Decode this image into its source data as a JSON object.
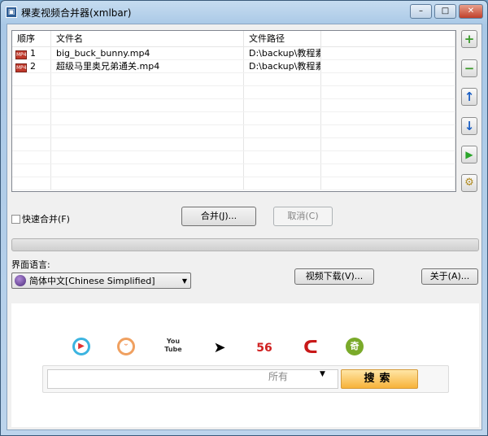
{
  "window": {
    "title": "稞麦视频合并器(xmlbar)",
    "minimize": "–",
    "maximize": "□",
    "close": "✕"
  },
  "table": {
    "headers": [
      "顺序",
      "文件名",
      "文件路径",
      ""
    ],
    "rows": [
      {
        "order": "1",
        "name": "big_buck_bunny.mp4",
        "path": "D:\\backup\\教程素材"
      },
      {
        "order": "2",
        "name": "超级马里奥兄弟通关.mp4",
        "path": "D:\\backup\\教程素材"
      }
    ],
    "file_icon": "MP4"
  },
  "side_buttons": {
    "add": "+",
    "remove": "−",
    "up": "↑",
    "down": "↓",
    "play": "▶",
    "settings": "⚙"
  },
  "fast_merge_label": "快速合并(F)",
  "merge_button": "合并(J)...",
  "cancel_button": "取消(C)",
  "progress": 0,
  "language_label": "界面语言:",
  "language_value": "简体中文[Chinese Simplified]",
  "video_download_button": "视频下载(V)...",
  "about_button": "关于(A)...",
  "sites": {
    "youtube": "You Tube",
    "s56": "56",
    "iqiyi": "奇"
  },
  "search": {
    "scope": "所有",
    "button": "搜索"
  }
}
